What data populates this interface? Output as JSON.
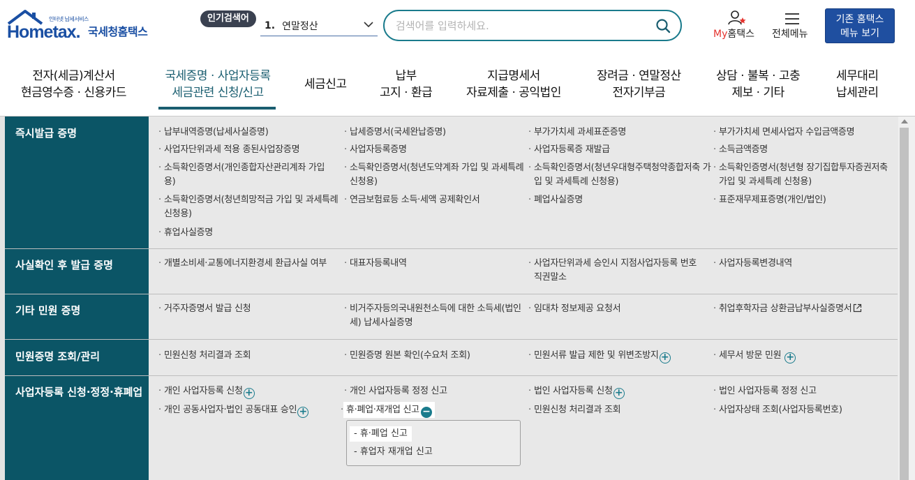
{
  "header": {
    "logo_tagline": "인터넷 납세서비스",
    "logo_brand": "Hometax.",
    "logo_brand_ko": "국세청홈택스",
    "popular_badge": "인기검색어",
    "popular_rank": "1.",
    "popular_term": "연말정산",
    "search_placeholder": "검색어를 입력하세요.",
    "search_value": "",
    "my_prefix": "My",
    "my_suffix": "홈택스",
    "all_menu": "전체메뉴",
    "old_menu_line1": "기존 홈택스",
    "old_menu_line2": "메뉴 보기"
  },
  "nav": [
    {
      "line1": "전자(세금)계산서",
      "line2": "현금영수증 · 신용카드"
    },
    {
      "line1": "국세증명 · 사업자등록",
      "line2": "세금관련 신청/신고",
      "active": true
    },
    {
      "line1": "세금신고",
      "line2": ""
    },
    {
      "line1": "납부",
      "line2": "고지 · 환급"
    },
    {
      "line1": "지급명세서",
      "line2": "자료제출 · 공익법인"
    },
    {
      "line1": "장려금 · 연말정산",
      "line2": "전자기부금"
    },
    {
      "line1": "상담 · 불복 · 고충",
      "line2": "제보 · 기타"
    },
    {
      "line1": "세무대리",
      "line2": "납세관리"
    }
  ],
  "sections": [
    {
      "title": "즉시발급 증명",
      "items": [
        "납부내역증명(납세사실증명)",
        "납세증명서(국세완납증명)",
        "부가가치세 과세표준증명",
        "부가가치세 면세사업자 수입금액증명",
        "사업자단위과세 적용 종된사업장증명",
        "사업자등록증명",
        "사업자등록증 재발급",
        "소득금액증명",
        "소득확인증명서(개인종합자산관리계좌 가입용)",
        "소득확인증명서(청년도약계좌 가입 및 과세특례 신청용)",
        "소득확인증명서(청년우대형주택청약종합저축 가입 및 과세특례 신청용)",
        "소득확인증명서(청년형 장기집합투자증권저축 가입 및 과세특례 신청용)",
        "소득확인증명서(청년희망적금 가입 및 과세특례 신청용)",
        "연금보험료등 소득·세액 공제확인서",
        "폐업사실증명",
        "표준재무제표증명(개인/법인)",
        "휴업사실증명"
      ]
    },
    {
      "title": "사실확인 후 발급 증명",
      "items": [
        "개별소비세·교통에너지환경세 환급사실 여부",
        "대표자등록내역",
        "사업자단위과세 승인시 지점사업자등록 번호 직권말소",
        "사업자등록변경내역"
      ]
    },
    {
      "title": "기타 민원 증명",
      "items": [
        "거주자증명서 발급 신청",
        "비거주자등의국내원천소득에 대한 소득세(법인세) 납세사실증명",
        "임대차 정보제공 요청서",
        "취업후학자금 상환금납부사실증명서"
      ]
    },
    {
      "title": "민원증명 조회/관리",
      "items": [
        "민원신청 처리결과 조회",
        "민원증명 원본 확인(수요처 조회)",
        "민원서류 발급 제한 및 위변조방지",
        "세무서 방문 민원"
      ]
    },
    {
      "title": "사업자등록 신청·정정·휴폐업",
      "items": [
        "개인 사업자등록 신청",
        "개인 사업자등록 정정 신고",
        "법인 사업자등록 신청",
        "법인 사업자등록 정정 신고",
        "개인 공동사업자·법인 공동대표 승인",
        "휴·폐업·재개업 신고",
        "민원신청 처리결과 조회",
        "사업자상태 조회(사업자등록번호)"
      ],
      "submenu": [
        "휴·폐업 신고",
        "휴업자 재개업 신고"
      ]
    }
  ],
  "colors": {
    "brand_blue": "#1a4fa3",
    "section_header": "#0b5566",
    "accent_teal": "#1a7b8c",
    "my_red": "#e5342f"
  }
}
